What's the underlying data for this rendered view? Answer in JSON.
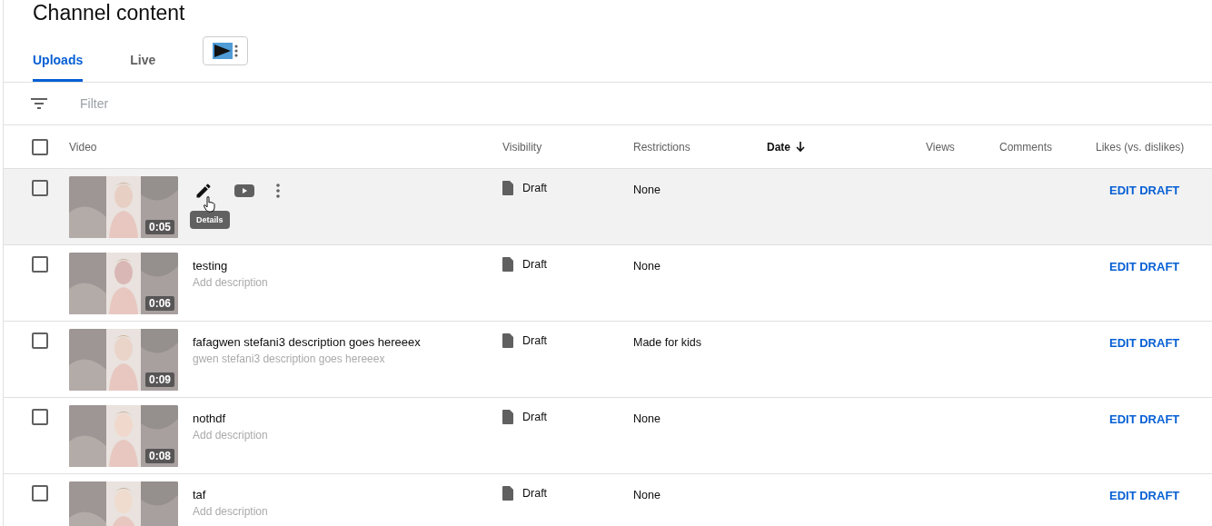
{
  "page_title": "Channel content",
  "tabs": [
    {
      "label": "Uploads",
      "selected": true
    },
    {
      "label": "Live",
      "selected": false
    }
  ],
  "filter": {
    "placeholder": "Filter"
  },
  "table": {
    "columns": [
      {
        "label": "Video",
        "sorted": false
      },
      {
        "label": "Visibility",
        "sorted": false
      },
      {
        "label": "Restrictions",
        "sorted": false
      },
      {
        "label": "Date",
        "sorted": true
      },
      {
        "label": "Views",
        "sorted": false
      },
      {
        "label": "Comments",
        "sorted": false
      },
      {
        "label": "Likes (vs. dislikes)",
        "sorted": false
      }
    ],
    "header_checked": false,
    "rows": [
      {
        "checked": false,
        "hovered": true,
        "duration": "0:05",
        "tooltip": "Details",
        "visibility": "Draft",
        "restrictions": "None",
        "action": "EDIT DRAFT"
      },
      {
        "checked": false,
        "hovered": false,
        "duration": "0:06",
        "title": "testing",
        "description": "Add description",
        "visibility": "Draft",
        "restrictions": "None",
        "action": "EDIT DRAFT"
      },
      {
        "checked": false,
        "hovered": false,
        "duration": "0:09",
        "title": "fafagwen stefani3 description goes hereeex",
        "description": "gwen stefani3 description goes hereeex",
        "visibility": "Draft",
        "restrictions": "Made for kids",
        "action": "EDIT DRAFT"
      },
      {
        "checked": false,
        "hovered": false,
        "duration": "0:08",
        "title": "nothdf",
        "description": "Add description",
        "visibility": "Draft",
        "restrictions": "None",
        "action": "EDIT DRAFT"
      },
      {
        "checked": false,
        "hovered": false,
        "title": "taf",
        "description": "Add description",
        "visibility": "Draft",
        "restrictions": "None",
        "action": "EDIT DRAFT"
      }
    ]
  }
}
